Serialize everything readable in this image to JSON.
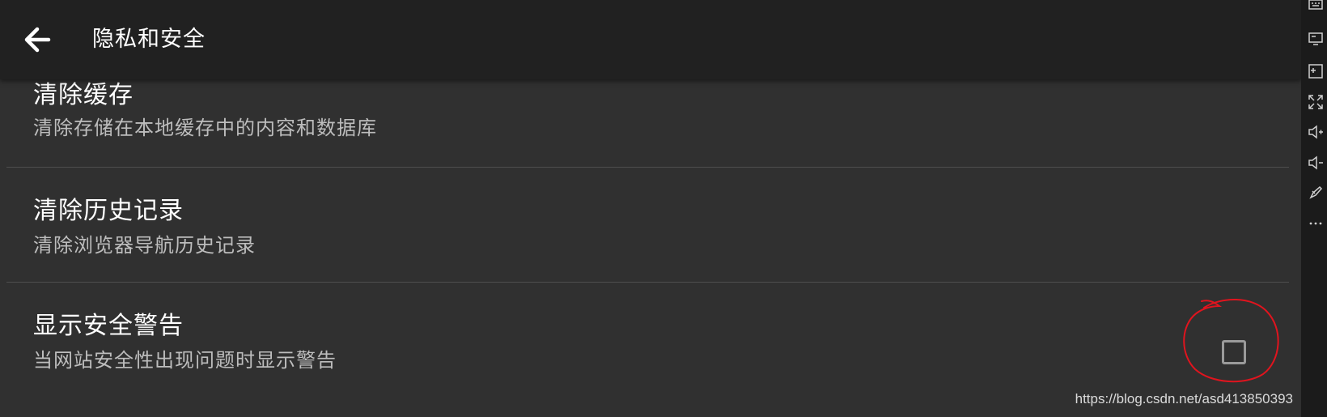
{
  "header": {
    "title": "隐私和安全",
    "back_icon": "arrow-left-icon"
  },
  "settings": [
    {
      "title": "清除缓存",
      "subtitle": "清除存储在本地缓存中的内容和数据库"
    },
    {
      "title": "清除历史记录",
      "subtitle": "清除浏览器导航历史记录"
    },
    {
      "title": "显示安全警告",
      "subtitle": "当网站安全性出现问题时显示警告",
      "checkbox_checked": false
    }
  ],
  "annotation": {
    "type": "hand-drawn-circle",
    "color": "#e0141e"
  },
  "side_toolbar": {
    "icons": [
      "keyboard-icon",
      "screen-icon",
      "screenshot-icon",
      "fullscreen-icon",
      "volume-up-icon",
      "volume-down-icon",
      "rocket-icon",
      "more-icon"
    ]
  },
  "watermark": "https://blog.csdn.net/asd413850393",
  "colors": {
    "background": "#303030",
    "appbar": "#212121",
    "text_primary": "#ffffff",
    "text_secondary": "#bdbdbd",
    "divider": "#4e4e4e",
    "annotation": "#e0141e"
  }
}
